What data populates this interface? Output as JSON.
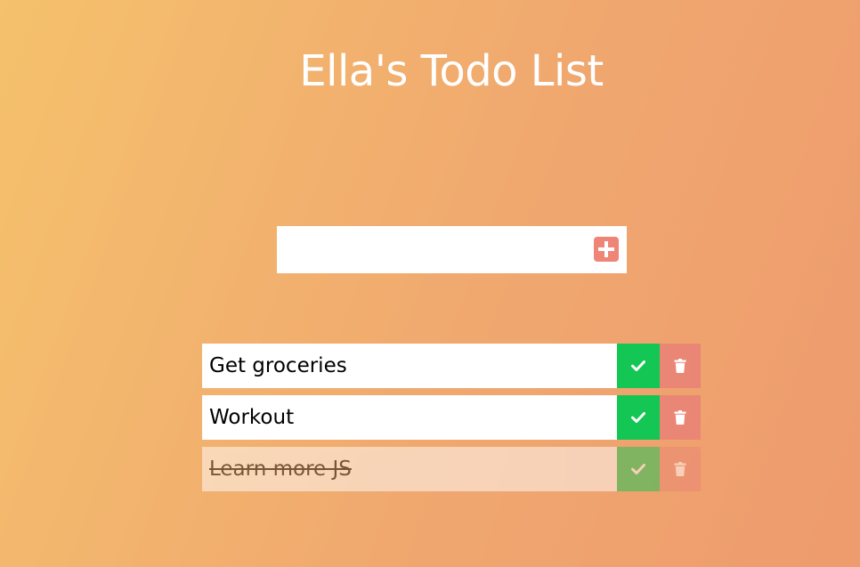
{
  "header": {
    "title": "Ella's Todo List"
  },
  "add_form": {
    "input_value": "",
    "placeholder": "",
    "button_icon": "plus-square-icon"
  },
  "todos": [
    {
      "text": "Get groceries",
      "completed": false
    },
    {
      "text": "Workout",
      "completed": false
    },
    {
      "text": "Learn more JS",
      "completed": true
    }
  ],
  "colors": {
    "gradient_start": "#f5c16c",
    "gradient_end": "#ee9b6e",
    "check_green": "#14c653",
    "trash_red": "#ea8676",
    "add_button": "#ee8576"
  }
}
